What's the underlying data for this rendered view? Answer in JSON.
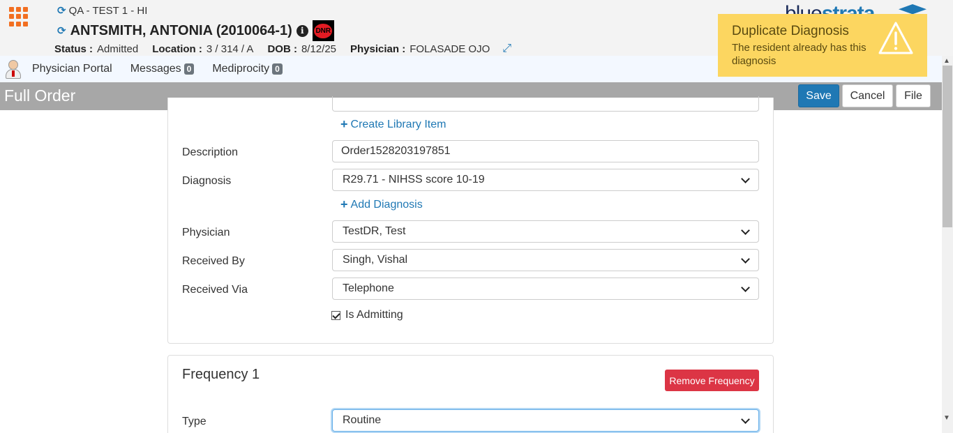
{
  "header": {
    "facility": "QA - TEST 1 - HI",
    "patient_name": "ANTSMITH, ANTONIA (2010064-1)",
    "dnr_label": "DNR",
    "status_label": "Status :",
    "status_value": "Admitted",
    "location_label": "Location :",
    "location_value": "3 / 314 / A",
    "dob_label": "DOB :",
    "dob_value": "8/12/25",
    "physician_label": "Physician :",
    "physician_value": "FOLASADE OJO",
    "brand_light": "blue",
    "brand_bold": "strata"
  },
  "nav": {
    "items": [
      {
        "label": "Physician Portal"
      },
      {
        "label": "Messages",
        "count": "0"
      },
      {
        "label": "Mediprocity",
        "count": "0"
      }
    ]
  },
  "toast": {
    "title": "Duplicate Diagnosis",
    "message": "The resident already has this diagnosis",
    "color": "#fcd660"
  },
  "titlebar": {
    "title": "Full Order",
    "save": "Save",
    "cancel": "Cancel",
    "file": "File"
  },
  "order": {
    "create_library_item": "Create Library Item",
    "description_label": "Description",
    "description_value": "Order1528203197851",
    "diagnosis_label": "Diagnosis",
    "diagnosis_value": "R29.71 - NIHSS score 10-19",
    "add_diagnosis": "Add Diagnosis",
    "physician_label": "Physician",
    "physician_value": "TestDR, Test",
    "received_by_label": "Received By",
    "received_by_value": "Singh, Vishal",
    "received_via_label": "Received Via",
    "received_via_value": "Telephone",
    "is_admitting_label": "Is Admitting",
    "is_admitting_checked": true
  },
  "frequency": {
    "title": "Frequency 1",
    "remove_button": "Remove Frequency",
    "type_label": "Type",
    "type_value": "Routine"
  },
  "colors": {
    "accent": "#1f78b4",
    "apps_icon": "#f26f21",
    "danger": "#dc3545",
    "titlebar": "#a7a7a7"
  }
}
